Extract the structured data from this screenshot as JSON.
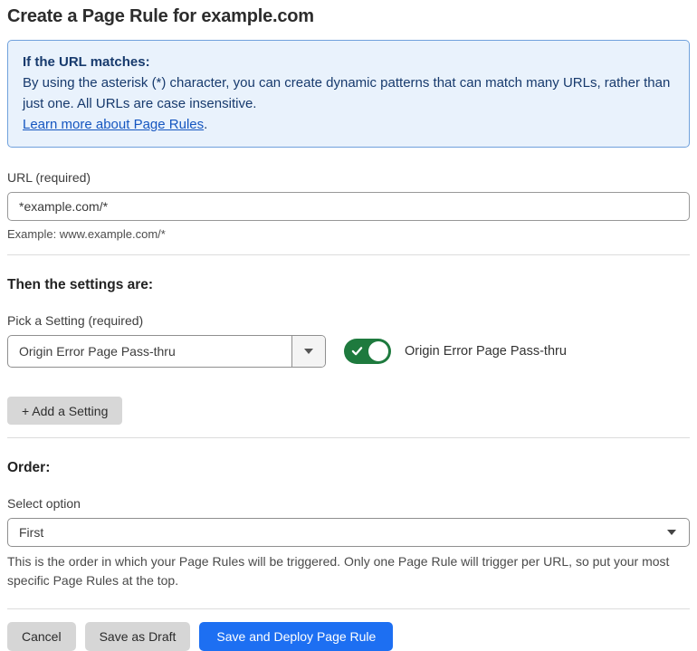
{
  "page": {
    "title": "Create a Page Rule for example.com"
  },
  "info_box": {
    "heading": "If the URL matches:",
    "body": "By using the asterisk (*) character, you can create dynamic patterns that can match many URLs, rather than just one. All URLs are case insensitive.",
    "link_label": "Learn more about Page Rules",
    "link_suffix": "."
  },
  "url_field": {
    "label": "URL (required)",
    "value": "*example.com/*",
    "helper": "Example: www.example.com/*"
  },
  "settings_section": {
    "heading": "Then the settings are:",
    "picker_label": "Pick a Setting (required)",
    "selected_setting": "Origin Error Page Pass-thru",
    "toggle_label": "Origin Error Page Pass-thru",
    "toggle_state": "on",
    "add_setting_label": "+ Add a Setting"
  },
  "order_section": {
    "heading": "Order:",
    "select_label": "Select option",
    "selected_option": "First",
    "helper": "This is the order in which your Page Rules will be triggered. Only one Page Rule will trigger per URL, so put your most specific Page Rules at the top."
  },
  "footer": {
    "cancel_label": "Cancel",
    "save_draft_label": "Save as Draft",
    "save_deploy_label": "Save and Deploy Page Rule"
  },
  "colors": {
    "accent_blue": "#1d6ff2",
    "info_background": "#e9f2fc",
    "info_border": "#70a1dc",
    "info_text": "#173a6d",
    "link_blue": "#1556c0",
    "toggle_green": "#1e7a3e",
    "button_gray": "#d6d6d6"
  }
}
